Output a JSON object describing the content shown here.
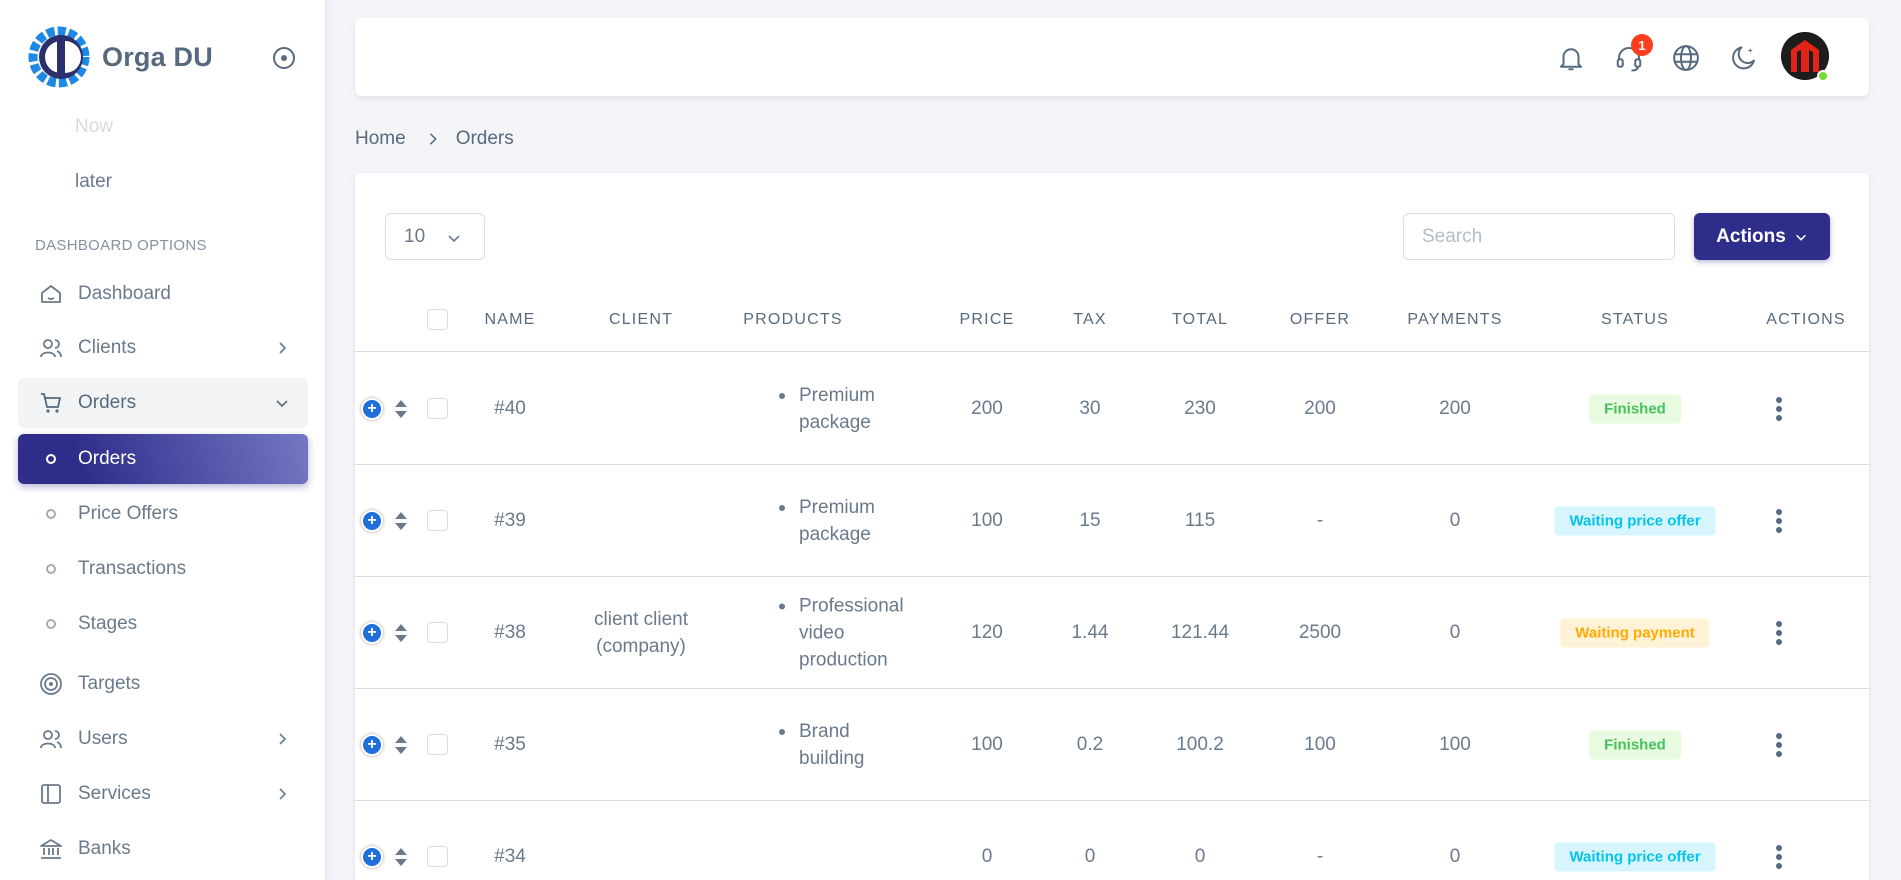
{
  "brand": {
    "name": "Orga DU"
  },
  "sidebar": {
    "sub_faded": "Now",
    "sub_later": "later",
    "header": "DASHBOARD OPTIONS",
    "items": {
      "dashboard": "Dashboard",
      "clients": "Clients",
      "orders": "Orders",
      "orders_sub": "Orders",
      "price_offers": "Price Offers",
      "transactions": "Transactions",
      "stages": "Stages",
      "targets": "Targets",
      "users": "Users",
      "services": "Services",
      "banks": "Banks"
    }
  },
  "navbar": {
    "notification_count": "1"
  },
  "breadcrumb": {
    "home": "Home",
    "current": "Orders"
  },
  "table_controls": {
    "per_page": "10",
    "search_placeholder": "Search",
    "actions_label": "Actions"
  },
  "columns": {
    "name": "NAME",
    "client": "CLIENT",
    "products": "PRODUCTS",
    "price": "PRICE",
    "tax": "TAX",
    "total": "TOTAL",
    "offer": "OFFER",
    "payments": "PAYMENTS",
    "status": "STATUS",
    "actions": "ACTIONS"
  },
  "rows": [
    {
      "name": "#40",
      "client": "",
      "products": [
        "Premium package"
      ],
      "price": "200",
      "tax": "30",
      "total": "230",
      "offer": "200",
      "payments": "200",
      "status": "Finished",
      "status_type": "success"
    },
    {
      "name": "#39",
      "client": "",
      "products": [
        "Premium package"
      ],
      "price": "100",
      "tax": "15",
      "total": "115",
      "offer": "-",
      "payments": "0",
      "status": "Waiting price offer",
      "status_type": "info"
    },
    {
      "name": "#38",
      "client": "client client (company)",
      "products": [
        "Professional video production"
      ],
      "price": "120",
      "tax": "1.44",
      "total": "121.44",
      "offer": "2500",
      "payments": "0",
      "status": "Waiting payment",
      "status_type": "warning"
    },
    {
      "name": "#35",
      "client": "",
      "products": [
        "Brand building"
      ],
      "price": "100",
      "tax": "0.2",
      "total": "100.2",
      "offer": "100",
      "payments": "100",
      "status": "Finished",
      "status_type": "success"
    },
    {
      "name": "#34",
      "client": "",
      "products": [],
      "price": "0",
      "tax": "0",
      "total": "0",
      "offer": "-",
      "payments": "0",
      "status": "Waiting price offer",
      "status_type": "info"
    }
  ],
  "colors": {
    "primary": "#2e2d8a",
    "success_bg": "#e8fadf",
    "success_fg": "#43c35a",
    "info_bg": "#d7f5fc",
    "info_fg": "#03c3ec",
    "warning_bg": "#fff2d6",
    "warning_fg": "#ffab00"
  }
}
